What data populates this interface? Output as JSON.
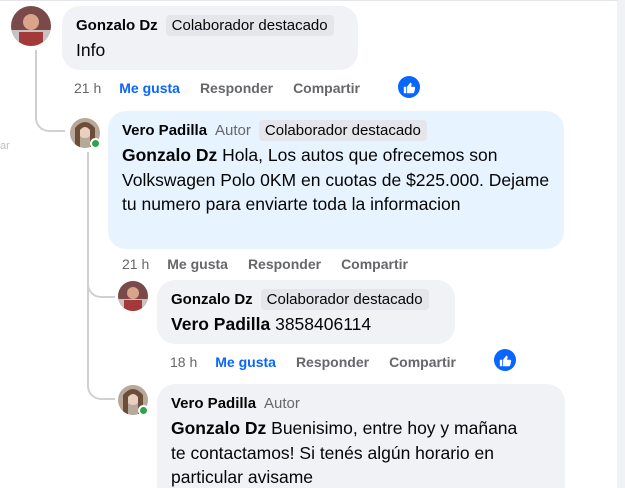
{
  "side_stub": {
    "text": "ar"
  },
  "comments": [
    {
      "author": "Gonzalo Dz",
      "author_tag": "",
      "badge": "Colaborador destacado",
      "mention": "",
      "text": "Info",
      "time": "21 h",
      "actions": {
        "like": "Me gusta",
        "reply": "Responder",
        "share": "Compartir"
      },
      "liked": true,
      "reaction_icon": "thumbs-up-icon"
    },
    {
      "author": "Vero Padilla",
      "author_tag": "Autor",
      "badge": "Colaborador destacado",
      "mention": "Gonzalo Dz",
      "text": "Hola, Los autos que ofrecemos son Volkswagen Polo 0KM en cuotas de $225.000. Dejame tu numero para enviarte toda la informacion",
      "time": "21 h",
      "actions": {
        "like": "Me gusta",
        "reply": "Responder",
        "share": "Compartir"
      },
      "liked": false
    },
    {
      "author": "Gonzalo Dz",
      "author_tag": "",
      "badge": "Colaborador destacado",
      "mention": "Vero Padilla",
      "text": "3858406114",
      "time": "18 h",
      "actions": {
        "like": "Me gusta",
        "reply": "Responder",
        "share": "Compartir"
      },
      "liked": true,
      "reaction_icon": "thumbs-up-icon"
    },
    {
      "author": "Vero Padilla",
      "author_tag": "Autor",
      "badge": "",
      "mention": "Gonzalo Dz",
      "text": "Buenisimo, entre hoy y mañana te contactamos! Si tenés algún horario en particular avisame"
    }
  ],
  "colors": {
    "like_blue": "#0866ff",
    "online_green": "#31a24c",
    "bubble_gray": "#f0f2f5",
    "bubble_blue": "#e7f3ff"
  }
}
